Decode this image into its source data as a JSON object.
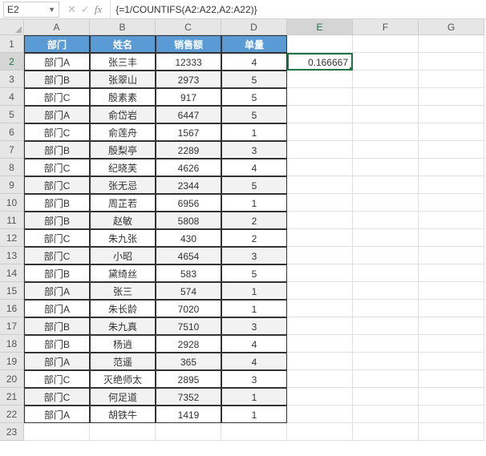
{
  "formula_bar": {
    "cell_ref": "E2",
    "cancel_icon": "✕",
    "confirm_icon": "✓",
    "fx_label": "fx",
    "formula": "{=1/COUNTIFS(A2:A22,A2:A22)}"
  },
  "columns": [
    "A",
    "B",
    "C",
    "D",
    "E",
    "F",
    "G"
  ],
  "active_col": "E",
  "active_row": 2,
  "headers": {
    "dept": "部门",
    "name": "姓名",
    "sales": "销售额",
    "qty": "单量"
  },
  "active_cell_value": "0.166667",
  "chart_data": {
    "type": "table",
    "columns": [
      "部门",
      "姓名",
      "销售额",
      "单量"
    ],
    "rows": [
      [
        "部门A",
        "张三丰",
        12333,
        4
      ],
      [
        "部门B",
        "张翠山",
        2973,
        5
      ],
      [
        "部门C",
        "殷素素",
        917,
        5
      ],
      [
        "部门A",
        "俞岱岩",
        6447,
        5
      ],
      [
        "部门C",
        "俞莲舟",
        1567,
        1
      ],
      [
        "部门B",
        "殷梨亭",
        2289,
        3
      ],
      [
        "部门C",
        "纪晓芙",
        4626,
        4
      ],
      [
        "部门C",
        "张无忌",
        2344,
        5
      ],
      [
        "部门B",
        "周芷若",
        6956,
        1
      ],
      [
        "部门B",
        "赵敏",
        5808,
        2
      ],
      [
        "部门C",
        "朱九张",
        430,
        2
      ],
      [
        "部门C",
        "小昭",
        4654,
        3
      ],
      [
        "部门B",
        "黛绮丝",
        583,
        5
      ],
      [
        "部门A",
        "张三",
        574,
        1
      ],
      [
        "部门A",
        "朱长龄",
        7020,
        1
      ],
      [
        "部门B",
        "朱九真",
        7510,
        3
      ],
      [
        "部门B",
        "杨逍",
        2928,
        4
      ],
      [
        "部门A",
        "范遥",
        365,
        4
      ],
      [
        "部门C",
        "灭绝师太",
        2895,
        3
      ],
      [
        "部门C",
        "何足道",
        7352,
        1
      ],
      [
        "部门A",
        "胡铁牛",
        1419,
        1
      ]
    ]
  },
  "row_count": 23
}
